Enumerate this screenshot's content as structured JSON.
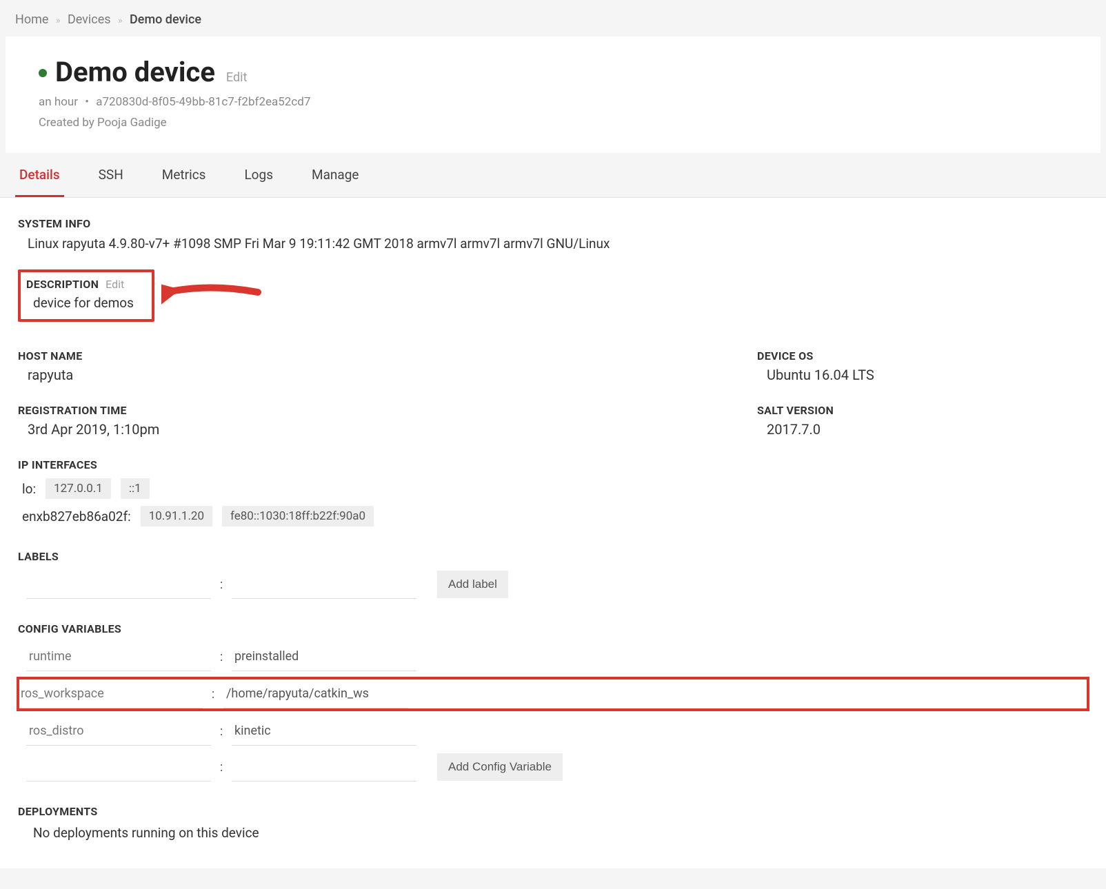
{
  "breadcrumb": {
    "home": "Home",
    "devices": "Devices",
    "current": "Demo device"
  },
  "header": {
    "title": "Demo device",
    "edit": "Edit",
    "age": "an hour",
    "uuid": "a720830d-8f05-49bb-81c7-f2bf2ea52cd7",
    "created_by_label": "Created by",
    "created_by": "Pooja Gadige"
  },
  "tabs": [
    "Details",
    "SSH",
    "Metrics",
    "Logs",
    "Manage"
  ],
  "active_tab": 0,
  "system_info": {
    "label": "SYSTEM INFO",
    "value": "Linux rapyuta 4.9.80-v7+ #1098 SMP Fri Mar 9 19:11:42 GMT 2018 armv7l armv7l armv7l GNU/Linux"
  },
  "description": {
    "label": "DESCRIPTION",
    "edit": "Edit",
    "value": "device for demos"
  },
  "left_fields": {
    "host_name": {
      "label": "HOST NAME",
      "value": "rapyuta"
    },
    "registration_time": {
      "label": "REGISTRATION TIME",
      "value": "3rd Apr 2019, 1:10pm"
    }
  },
  "right_fields": {
    "device_os": {
      "label": "DEVICE OS",
      "value": "Ubuntu 16.04 LTS"
    },
    "salt_version": {
      "label": "SALT VERSION",
      "value": "2017.7.0"
    }
  },
  "ip_interfaces": {
    "label": "IP INTERFACES",
    "rows": [
      {
        "name": "lo:",
        "ips": [
          "127.0.0.1",
          "::1"
        ]
      },
      {
        "name": "enxb827eb86a02f:",
        "ips": [
          "10.91.1.20",
          "fe80::1030:18ff:b22f:90a0"
        ]
      }
    ]
  },
  "labels_section": {
    "label": "LABELS",
    "add_button": "Add label"
  },
  "config_vars": {
    "label": "CONFIG VARIABLES",
    "rows": [
      {
        "key": "runtime",
        "value": "preinstalled",
        "highlight": false
      },
      {
        "key": "ros_workspace",
        "value": "/home/rapyuta/catkin_ws",
        "highlight": true
      },
      {
        "key": "ros_distro",
        "value": "kinetic",
        "highlight": false
      }
    ],
    "add_button": "Add Config Variable"
  },
  "deployments": {
    "label": "DEPLOYMENTS",
    "value": "No deployments running on this device"
  },
  "annotation": {
    "arrow_color": "#d9362e"
  }
}
